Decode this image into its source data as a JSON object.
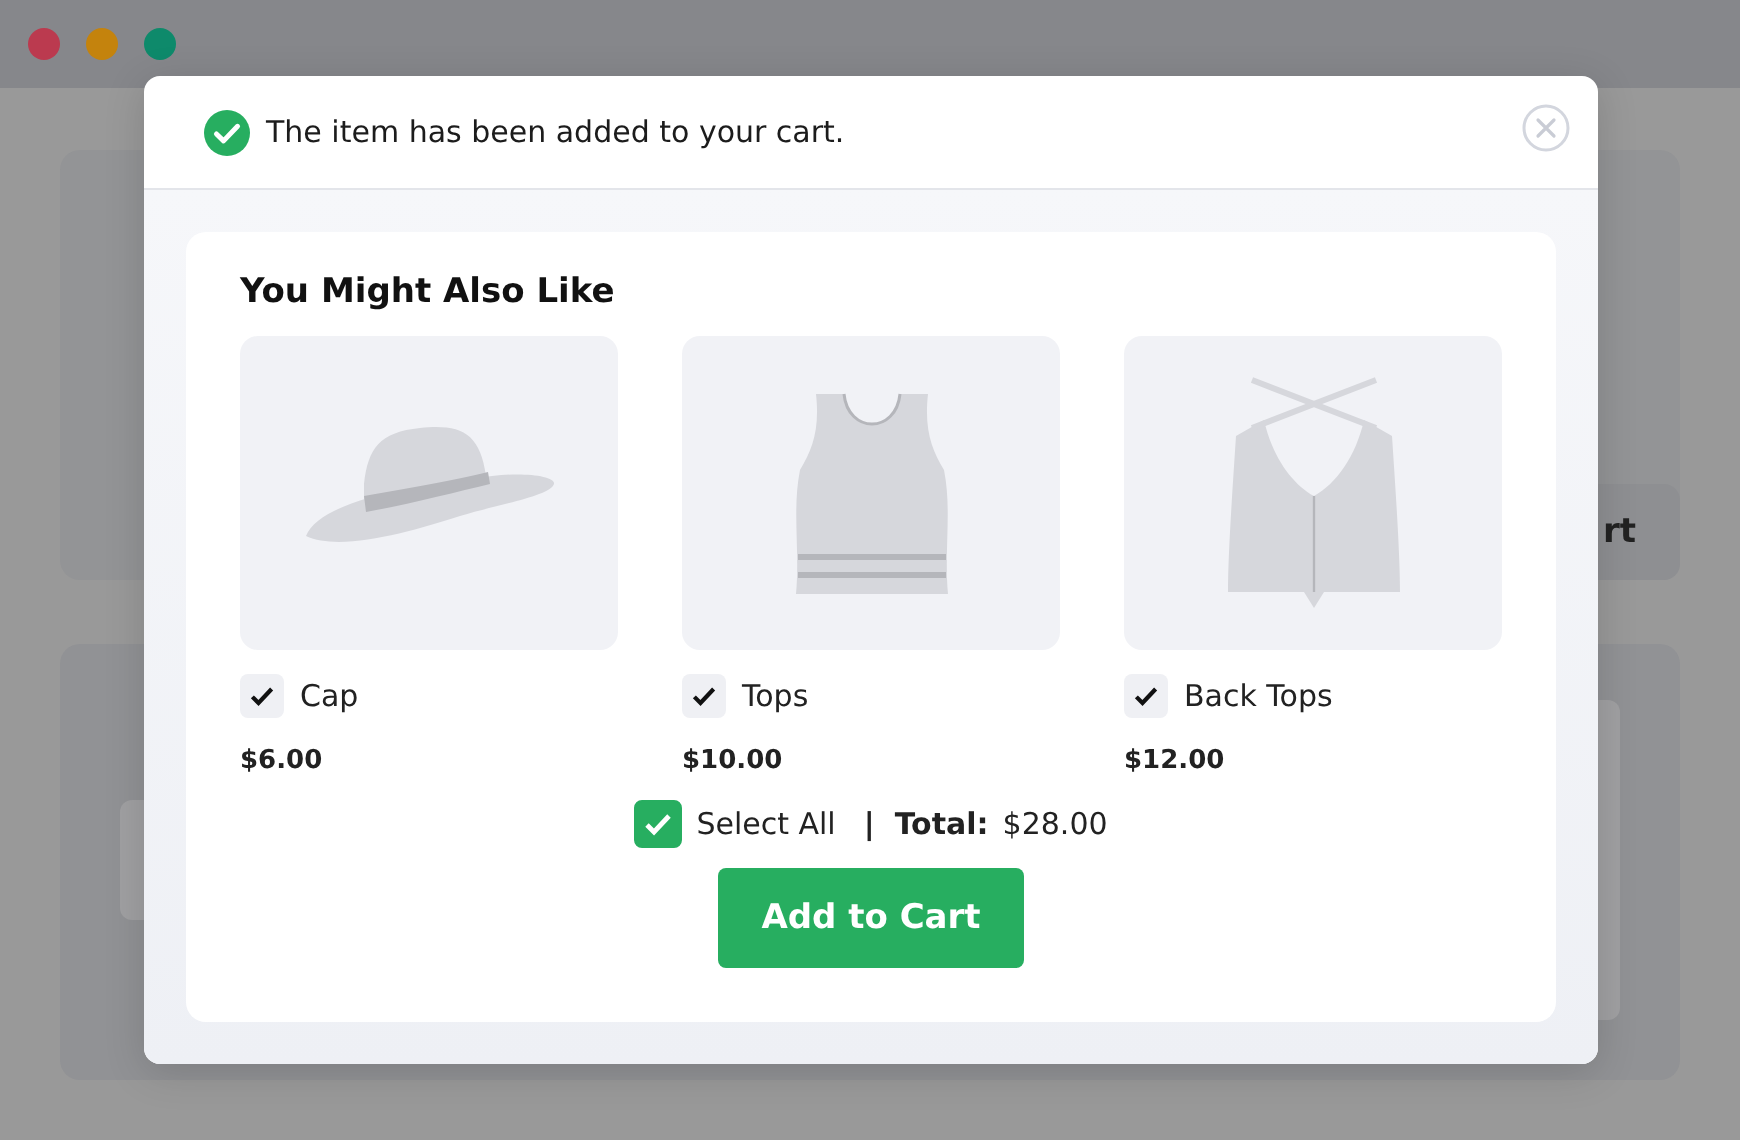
{
  "window_controls": [
    {
      "color": "#bb3a4f"
    },
    {
      "color": "#c4830d"
    },
    {
      "color": "#0e8a6b"
    }
  ],
  "background": {
    "button": {
      "label": "rt"
    }
  },
  "notification": {
    "message": "The item has been added to your cart.",
    "checked": true
  },
  "recommendations": {
    "title": "You Might Also Like",
    "products": [
      {
        "kind": "hat",
        "name": "Cap",
        "price": "$6.00",
        "checked": true
      },
      {
        "kind": "tank-top",
        "name": "Tops",
        "price": "$10.00",
        "checked": true
      },
      {
        "kind": "cross-back-top",
        "name": "Back Tops",
        "price": "$12.00",
        "checked": true
      }
    ]
  },
  "select_all": {
    "label": "Select All",
    "checked": true
  },
  "total": {
    "separator": "|",
    "label": "Total:",
    "value": "$28.00"
  },
  "add_button": {
    "label": "Add to Cart"
  }
}
